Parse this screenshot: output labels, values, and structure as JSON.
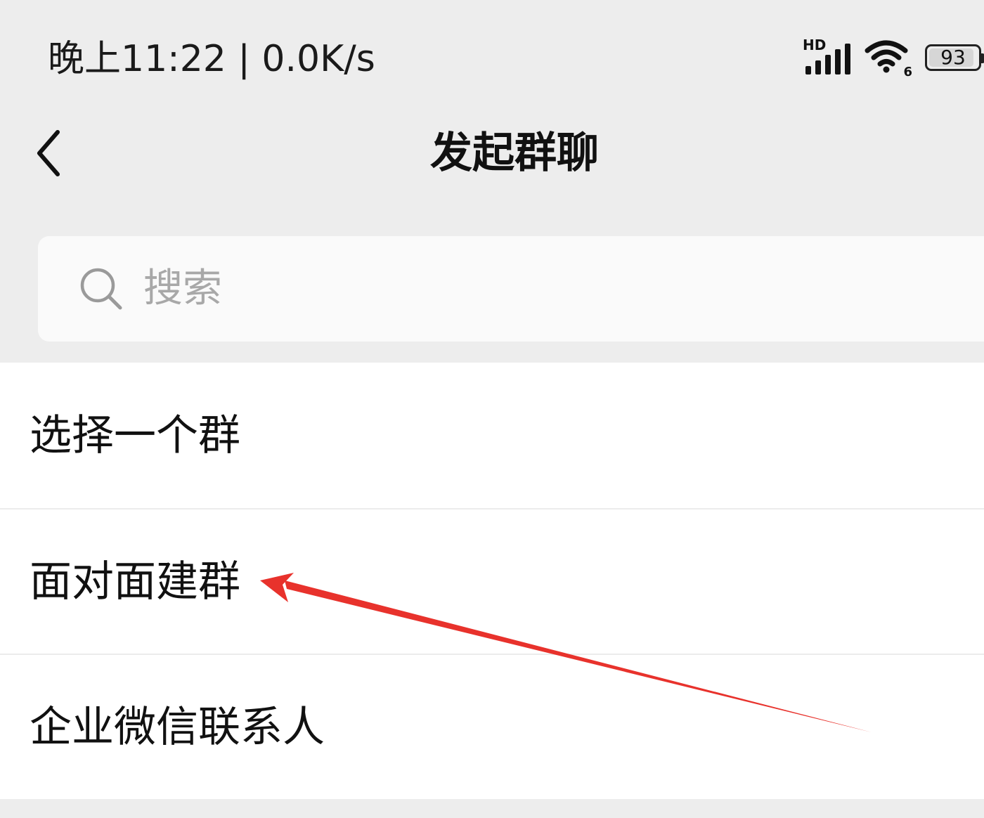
{
  "status_bar": {
    "time_speed": "晚上11:22 | 0.0K/s",
    "hd_label": "HD",
    "wifi_badge": "6",
    "battery_level": "93",
    "battery_fraction": 0.93,
    "signal_icon": "signal-bars-icon",
    "wifi_icon": "wifi-icon"
  },
  "nav": {
    "back_icon": "chevron-left-icon",
    "title": "发起群聊"
  },
  "search": {
    "icon": "search-icon",
    "placeholder": "搜索"
  },
  "options": [
    {
      "label": "选择一个群"
    },
    {
      "label": "面对面建群"
    },
    {
      "label": "企业微信联系人"
    }
  ],
  "annotation": {
    "arrow_color": "#e8322c",
    "points_to": "面对面建群"
  },
  "colors": {
    "background": "#ededed",
    "list_background": "#ffffff",
    "placeholder": "#a8a8a8"
  }
}
